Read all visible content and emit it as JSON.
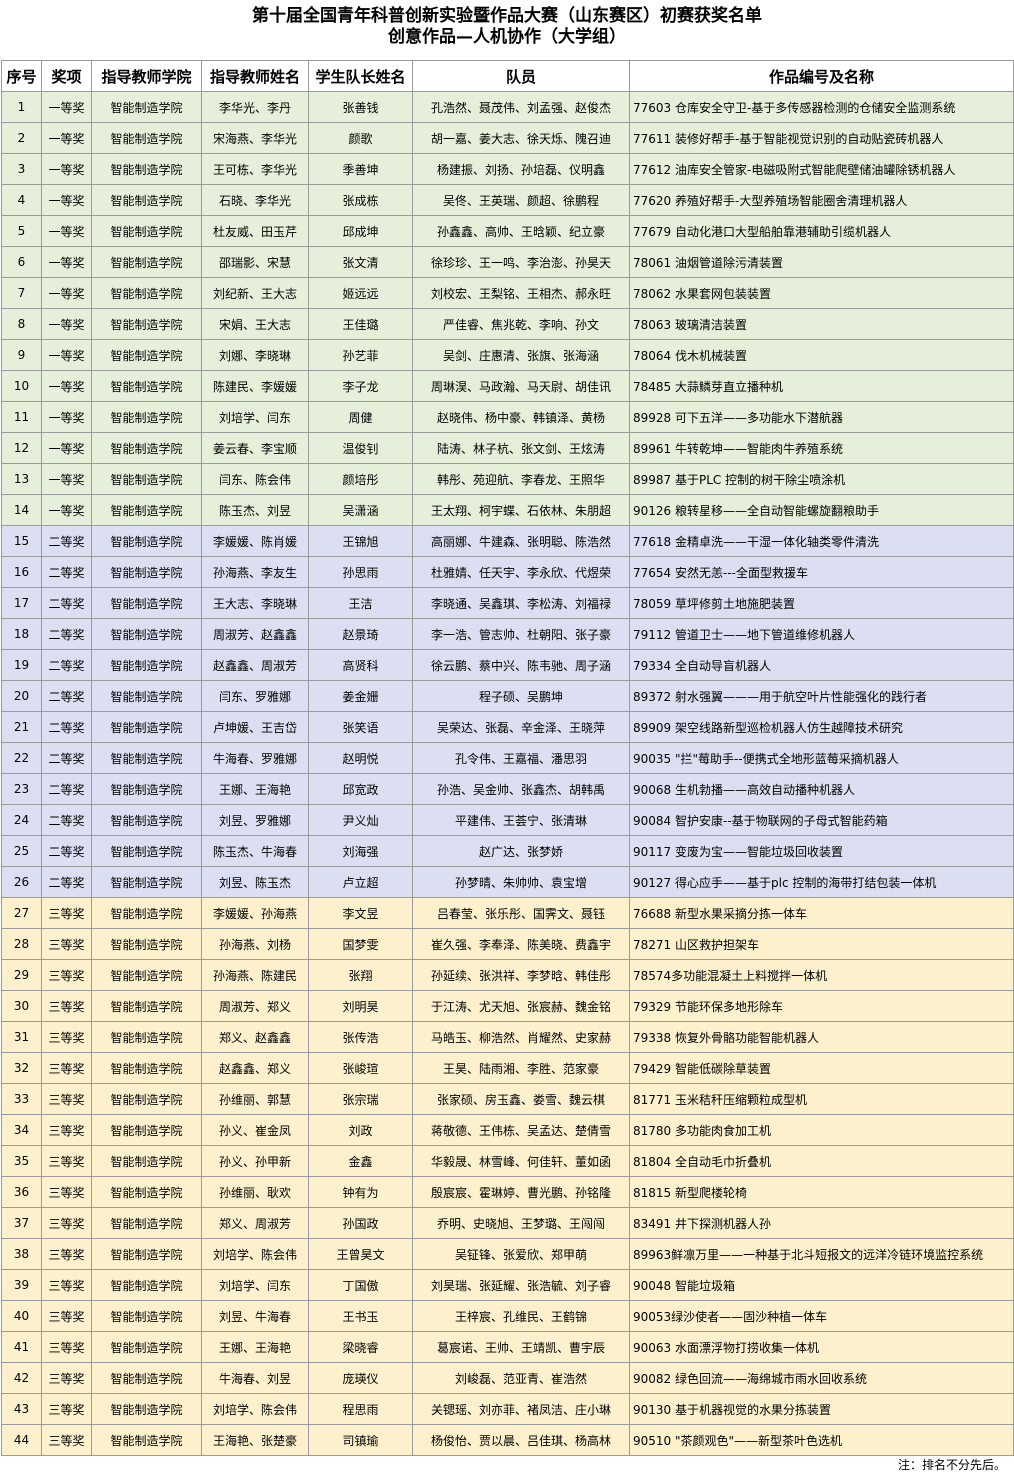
{
  "title": "第十届全国青年科普创新实验暨作品大赛（山东赛区）初赛获奖名单",
  "subtitle": "创意作品—人机协作（大学组）",
  "headers": [
    "序号",
    "奖项",
    "指导教师学院",
    "指导教师姓名",
    "学生队长姓名",
    "队员",
    "作品编号及名称"
  ],
  "rows": [
    [
      "1",
      "一等奖",
      "智能制造学院",
      "李华光、李丹",
      "张善钱",
      "孔浩然、聂茂伟、刘孟强、赵俊杰",
      "77603 仓库安全守卫-基于多传感器检测的仓储安全监测系统"
    ],
    [
      "2",
      "一等奖",
      "智能制造学院",
      "宋海燕、李华光",
      "颜歌",
      "胡一嘉、姜大志、徐天烁、隗召迪",
      "77611 装修好帮手-基于智能视觉识别的自动贴瓷砖机器人"
    ],
    [
      "3",
      "一等奖",
      "智能制造学院",
      "王可栋、李华光",
      "季善坤",
      "杨建振、刘扬、孙培磊、仪明鑫",
      "77612 油库安全管家-电磁吸附式智能爬壁储油罐除锈机器人"
    ],
    [
      "4",
      "一等奖",
      "智能制造学院",
      "石晓、李华光",
      "张成栋",
      "吴佟、王英瑞、颜超、徐鹏程",
      "77620 养殖好帮手-大型养殖场智能圈舍清理机器人"
    ],
    [
      "5",
      "一等奖",
      "智能制造学院",
      "杜友威、田玉芹",
      "邱成坤",
      "孙鑫鑫、高帅、王晗颖、纪立豪",
      "77679 自动化港口大型船舶靠港辅助引缆机器人"
    ],
    [
      "6",
      "一等奖",
      "智能制造学院",
      "邵瑞影、宋慧",
      "张文清",
      "徐珍珍、王一鸣、李治澎、孙昊天",
      "78061 油烟管道除污清装置"
    ],
    [
      "7",
      "一等奖",
      "智能制造学院",
      "刘纪新、王大志",
      "姬远远",
      "刘校宏、王梨铭、王相杰、郝永旺",
      "78062 水果套网包装装置"
    ],
    [
      "8",
      "一等奖",
      "智能制造学院",
      "宋娟、王大志",
      "王佳璐",
      "严佳睿、焦兆乾、李响、孙文",
      "78063 玻璃清洁装置"
    ],
    [
      "9",
      "一等奖",
      "智能制造学院",
      "刘娜、李晓琳",
      "孙艺菲",
      "吴剑、庄惠清、张旗、张海涵",
      "78064 伐木机械装置"
    ],
    [
      "10",
      "一等奖",
      "智能制造学院",
      "陈建民、李媛媛",
      "李子龙",
      "周琳淏、马政瀚、马天尉、胡佳讯",
      "78485 大蒜鳞芽直立播种机"
    ],
    [
      "11",
      "一等奖",
      "智能制造学院",
      "刘培学、闫东",
      "周健",
      "赵晓伟、杨中豪、韩镇泽、黄杨",
      "89928 可下五洋——多功能水下潜航器"
    ],
    [
      "12",
      "一等奖",
      "智能制造学院",
      "姜云春、李宝顺",
      "温俊钊",
      "陆涛、林子杭、张文剑、王炫涛",
      "89961 牛转乾坤——智能肉牛养殖系统"
    ],
    [
      "13",
      "一等奖",
      "智能制造学院",
      "闫东、陈会伟",
      "颜培彤",
      "韩彤、苑迎航、李春龙、王照华",
      "89987 基于PLC 控制的树干除尘喷涂机"
    ],
    [
      "14",
      "一等奖",
      "智能制造学院",
      "陈玉杰、刘昱",
      "吴潇涵",
      "王太翔、柯宇蝶、石依林、朱朋超",
      "90126 粮转星移——全自动智能螺旋翻粮助手"
    ],
    [
      "15",
      "二等奖",
      "智能制造学院",
      "李媛媛、陈肖媛",
      "王锦旭",
      "高丽娜、牛建森、张明聪、陈浩然",
      "77618 金精卓洗——干湿一体化轴类零件清洗"
    ],
    [
      "16",
      "二等奖",
      "智能制造学院",
      "孙海燕、李友生",
      "孙思雨",
      "杜雅婧、任天宇、李永欣、代煜荣",
      "77654 安然无恙---全面型救援车"
    ],
    [
      "17",
      "二等奖",
      "智能制造学院",
      "王大志、李晓琳",
      "王洁",
      "李晓通、吴鑫琪、李松涛、刘福禄",
      "78059 草坪修剪土地施肥装置"
    ],
    [
      "18",
      "二等奖",
      "智能制造学院",
      "周淑芳、赵鑫鑫",
      "赵景琦",
      "李一浩、管志帅、杜朝阳、张子豪",
      "79112 管道卫士——地下管道维修机器人"
    ],
    [
      "19",
      "二等奖",
      "智能制造学院",
      "赵鑫鑫、周淑芳",
      "高贤科",
      "徐云鹏、蔡中兴、陈韦驰、周子涵",
      "79334 全自动导盲机器人"
    ],
    [
      "20",
      "二等奖",
      "智能制造学院",
      "闫东、罗雅娜",
      "姜金姗",
      "程子硕、吴鹏坤",
      "89372 射水强翼———用于航空叶片性能强化的践行者"
    ],
    [
      "21",
      "二等奖",
      "智能制造学院",
      "卢坤媛、王吉岱",
      "张笑语",
      "吴荣达、张磊、辛金泽、王晓萍",
      "89909 架空线路新型巡检机器人仿生越障技术研究"
    ],
    [
      "22",
      "二等奖",
      "智能制造学院",
      "牛海春、罗雅娜",
      "赵明悦",
      "孔令伟、王嘉福、潘思羽",
      "90035 \"拦\"莓助手--便携式全地形蓝莓采摘机器人"
    ],
    [
      "23",
      "二等奖",
      "智能制造学院",
      "王娜、王海艳",
      "邱宽政",
      "孙浩、吴金帅、张鑫杰、胡韩禹",
      "90068 生机勃播——高效自动播种机器人"
    ],
    [
      "24",
      "二等奖",
      "智能制造学院",
      "刘昱、罗雅娜",
      "尹义灿",
      "平建伟、王荟宁、张清琳",
      "90084 智护安康--基于物联网的子母式智能药箱"
    ],
    [
      "25",
      "二等奖",
      "智能制造学院",
      "陈玉杰、牛海春",
      "刘海强",
      "赵广达、张梦娇",
      "90117 变废为宝——智能垃圾回收装置"
    ],
    [
      "26",
      "二等奖",
      "智能制造学院",
      "刘昱、陈玉杰",
      "卢立超",
      "孙梦晴、朱帅帅、袁宝增",
      "90127 得心应手——基于plc 控制的海带打结包装一体机"
    ],
    [
      "27",
      "三等奖",
      "智能制造学院",
      "李媛媛、孙海燕",
      "李文昱",
      "吕春莹、张乐彤、国霁文、聂钰",
      "76688 新型水果采摘分拣一体车"
    ],
    [
      "28",
      "三等奖",
      "智能制造学院",
      "孙海燕、刘杨",
      "国梦雯",
      "崔久强、李奉泽、陈美晓、费鑫宇",
      "78271 山区救护担架车"
    ],
    [
      "29",
      "三等奖",
      "智能制造学院",
      "孙海燕、陈建民",
      "张翔",
      "孙延续、张洪祥、李梦晗、韩佳彤",
      "78574多功能混凝土上料搅拌一体机"
    ],
    [
      "30",
      "三等奖",
      "智能制造学院",
      "周淑芳、郑义",
      "刘明昊",
      "于江涛、尤天旭、张宸赫、魏金铭",
      "79329 节能环保多地形除车"
    ],
    [
      "31",
      "三等奖",
      "智能制造学院",
      "郑义、赵鑫鑫",
      "张传浩",
      "马皓玉、柳浩然、肖耀然、史家赫",
      "79338 恢复外骨骼功能智能机器人"
    ],
    [
      "32",
      "三等奖",
      "智能制造学院",
      "赵鑫鑫、郑义",
      "张峻瑄",
      "王昊、陆雨湘、李胜、范家豪",
      "79429 智能低碳除草装置"
    ],
    [
      "33",
      "三等奖",
      "智能制造学院",
      "孙维丽、郭慧",
      "张宗瑞",
      "张家硕、房玉鑫、娄雪、魏云棋",
      "81771 玉米秸秆压缩颗粒成型机"
    ],
    [
      "34",
      "三等奖",
      "智能制造学院",
      "孙义、崔金凤",
      "刘政",
      "蒋敬德、王伟栋、吴孟达、楚倩雪",
      "81780 多功能肉食加工机"
    ],
    [
      "35",
      "三等奖",
      "智能制造学院",
      "孙义、孙甲新",
      "金鑫",
      "华毅晟、林雪峰、何佳轩、董如函",
      "81804 全自动毛巾折叠机"
    ],
    [
      "36",
      "三等奖",
      "智能制造学院",
      "孙维丽、耿欢",
      "钟有为",
      "殷宸宸、霍琳婷、曹光鹏、孙铭隆",
      "81815 新型爬楼轮椅"
    ],
    [
      "37",
      "三等奖",
      "智能制造学院",
      "郑义、周淑芳",
      "孙国政",
      "乔明、史晓旭、王梦璐、王闯闯",
      "83491 井下探测机器人孙"
    ],
    [
      "38",
      "三等奖",
      "智能制造学院",
      "刘培学、陈会伟",
      "王曾昊文",
      "吴钲锋、张爱欣、郑甲萌",
      "89963鲜凛万里——一种基于北斗短报文的远洋冷链环境监控系统"
    ],
    [
      "39",
      "三等奖",
      "智能制造学院",
      "刘培学、闫东",
      "丁国傲",
      "刘昊瑞、张延耀、张浩毓、刘子睿",
      "90048 智能垃圾箱"
    ],
    [
      "40",
      "三等奖",
      "智能制造学院",
      "刘昱、牛海春",
      "王书玉",
      "王梓宸、孔维民、王鹤锦",
      "90053绿沙使者——固沙种植一体车"
    ],
    [
      "41",
      "三等奖",
      "智能制造学院",
      "王娜、王海艳",
      "梁晓睿",
      "葛宸诺、王帅、王靖凯、曹宇辰",
      "90063 水面漂浮物打捞收集一体机"
    ],
    [
      "42",
      "三等奖",
      "智能制造学院",
      "牛海春、刘昱",
      "庞瑛仪",
      "刘峻磊、范亚青、崔浩然",
      "90082 绿色回流——海绵城市雨水回收系统"
    ],
    [
      "43",
      "三等奖",
      "智能制造学院",
      "刘培学、陈会伟",
      "程思雨",
      "关锶瑶、刘亦菲、褚凤洁、庄小琳",
      "90130 基于机器视觉的水果分拣装置"
    ],
    [
      "44",
      "三等奖",
      "智能制造学院",
      "王海艳、张楚豪",
      "司镇瑜",
      "杨俊怡、贾以晨、吕佳琪、杨高林",
      "90510 \"茶颜观色\"——新型茶叶色选机"
    ]
  ],
  "note": "注：排名不分先后。",
  "colors": {
    "first_prize": "#e6efd9",
    "second_prize": "#dcdff1",
    "third_prize": "#fdf0cd"
  }
}
